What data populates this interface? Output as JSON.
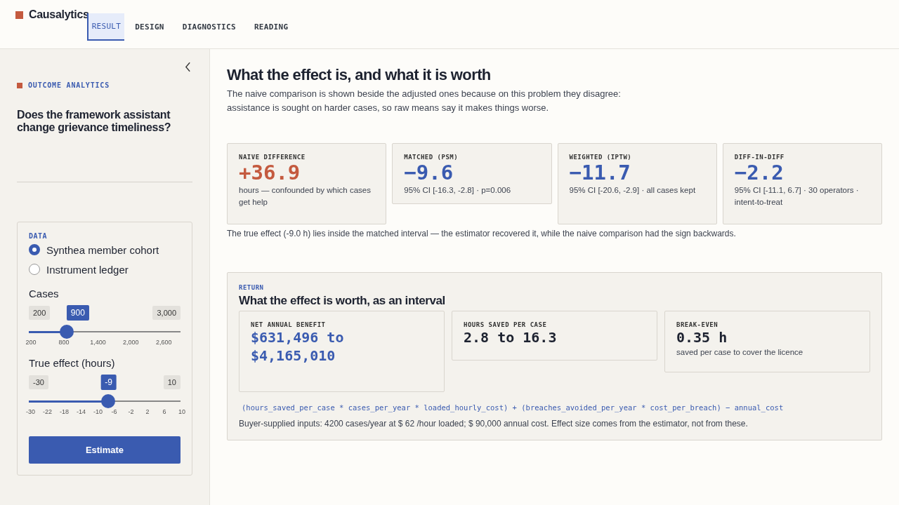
{
  "brand": "Causalytics",
  "tabs": [
    {
      "label": "RESULT",
      "selected": true
    },
    {
      "label": "DESIGN",
      "selected": false
    },
    {
      "label": "DIAGNOSTICS",
      "selected": false
    },
    {
      "label": "READING",
      "selected": false
    }
  ],
  "sidebar": {
    "eyebrow": "OUTCOME ANALYTICS",
    "question": "Does the framework assistant change grievance timeliness?",
    "data_label": "DATA",
    "sources": [
      {
        "label": "Synthea member cohort",
        "selected": true
      },
      {
        "label": "Instrument ledger",
        "selected": false
      }
    ],
    "sliders": [
      {
        "label": "Cases",
        "min": "200",
        "value": "900",
        "max": "3,000",
        "level": 0.25,
        "ticks": [
          "200",
          "800",
          "1,400",
          "2,000",
          "2,600"
        ]
      },
      {
        "label": "True effect (hours)",
        "min": "-30",
        "value": "-9",
        "max": "10",
        "level": 0.525,
        "ticks": [
          "-30",
          "-22",
          "-18",
          "-14",
          "-10",
          "-6",
          "-2",
          "2",
          "6",
          "10"
        ]
      }
    ],
    "button": "Estimate"
  },
  "main": {
    "title": "What the effect is, and what it is worth",
    "intro": "The naive comparison is shown beside the adjusted ones because on this problem they disagree: assistance is sought on harder cases, so raw means say it makes things worse.",
    "estimates": [
      {
        "label": "NAIVE DIFFERENCE",
        "value": "+36.9",
        "kind": "confounded",
        "note": "hours — confounded by which cases get help"
      },
      {
        "label": "MATCHED (PSM)",
        "value": "−9.6",
        "kind": "adjusted",
        "note": "95% CI [-16.3, -2.8] · p=0.006"
      },
      {
        "label": "WEIGHTED (IPTW)",
        "value": "−11.7",
        "kind": "adjusted",
        "note": "95% CI [-20.6, -2.9] · all cases kept"
      },
      {
        "label": "DIFF-IN-DIFF",
        "value": "−2.2",
        "kind": "adjusted",
        "note": "95% CI [-11.1, 6.7] · 30 operators · intent-to-treat"
      }
    ],
    "verdict": "The true effect (-9.0 h) lies inside the matched interval — the estimator recovered it, while the naive comparison had the sign backwards.",
    "return": {
      "eyebrow": "RETURN",
      "title": "What the effect is worth, as an interval",
      "cards": [
        {
          "label": "NET ANNUAL BENEFIT",
          "value": "$631,496 to $4,165,010",
          "kind": "highlight"
        },
        {
          "label": "HOURS SAVED PER CASE",
          "value": "2.8 to 16.3",
          "kind": "plain"
        },
        {
          "label": "BREAK-EVEN",
          "value": "0.35 h",
          "kind": "plain",
          "note": "saved per case to cover the licence"
        }
      ],
      "formula": "(hours_saved_per_case * cases_per_year * loaded_hourly_cost) + (breaches_avoided_per_year * cost_per_breach) − annual_cost",
      "footnote": "Buyer-supplied inputs: 4200 cases/year at $ 62 /hour loaded; $ 90,000 annual cost. Effect size comes from the estimator, not from these."
    }
  }
}
